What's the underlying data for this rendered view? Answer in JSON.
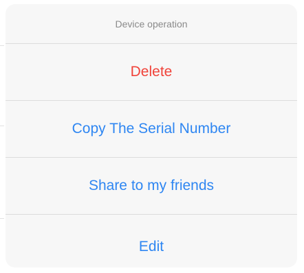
{
  "action_sheet": {
    "title": "Device operation",
    "actions": [
      {
        "label": "Delete",
        "style": "destructive",
        "color": "#f0433a"
      },
      {
        "label": "Copy The Serial Number",
        "style": "default",
        "color": "#2e86f2"
      },
      {
        "label": "Share to my friends",
        "style": "default",
        "color": "#2e86f2"
      },
      {
        "label": "Edit",
        "style": "default",
        "color": "#2e86f2"
      }
    ]
  }
}
